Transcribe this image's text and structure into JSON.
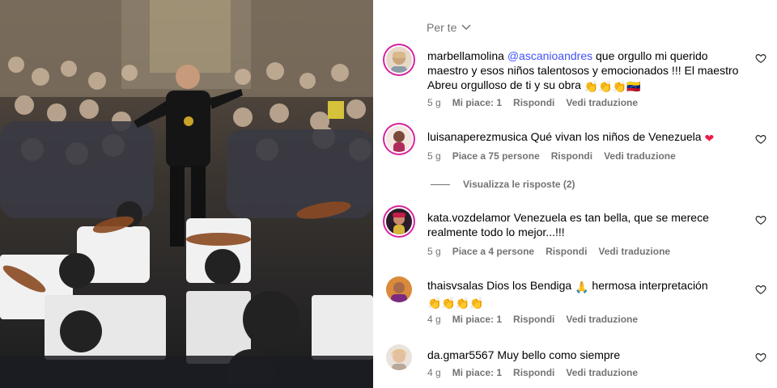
{
  "filter": {
    "label": "Per te"
  },
  "comments": [
    {
      "user": "marbellamolina",
      "mention": "@ascanioandres",
      "text": " que orgullo mi querido maestro y esos niños talentosos y emocionados !!! El maestro Abreu orgulloso de ti y su obra",
      "emojis": "👏👏👏🇻🇪",
      "time": "5 g",
      "likes": "Mi piace: 1",
      "reply": "Rispondi",
      "translate": "Vedi traduzione"
    },
    {
      "user": "luisanaperezmusica",
      "text": " Qué vivan los niños de Venezuela",
      "emojis": "❤",
      "time": "5 g",
      "likes": "Piace a 75 persone",
      "reply": "Rispondi",
      "translate": "Vedi traduzione"
    },
    {
      "user": "kata.vozdelamor",
      "text": " Venezuela es tan bella, que se merece realmente todo lo mejor...!!!",
      "time": "5 g",
      "likes": "Piace a 4 persone",
      "reply": "Rispondi",
      "translate": "Vedi traduzione"
    },
    {
      "user": "thaisvsalas",
      "text": " Dios los Bendiga",
      "emoji_mid": "🙏",
      "text2": " hermosa interpretación",
      "emojis": "👏👏👏👏",
      "time": "4 g",
      "likes": "Mi piace: 1",
      "reply": "Rispondi",
      "translate": "Vedi traduzione"
    },
    {
      "user": "da.gmar5567",
      "text": " Muy bello como siempre",
      "time": "4 g",
      "likes": "Mi piace: 1",
      "reply": "Rispondi",
      "translate": "Vedi traduzione"
    }
  ],
  "view_replies": "Visualizza le risposte (2)",
  "colors": {
    "mention": "#4150f7",
    "meta": "#737373",
    "heart_red": "#ed1b48"
  }
}
